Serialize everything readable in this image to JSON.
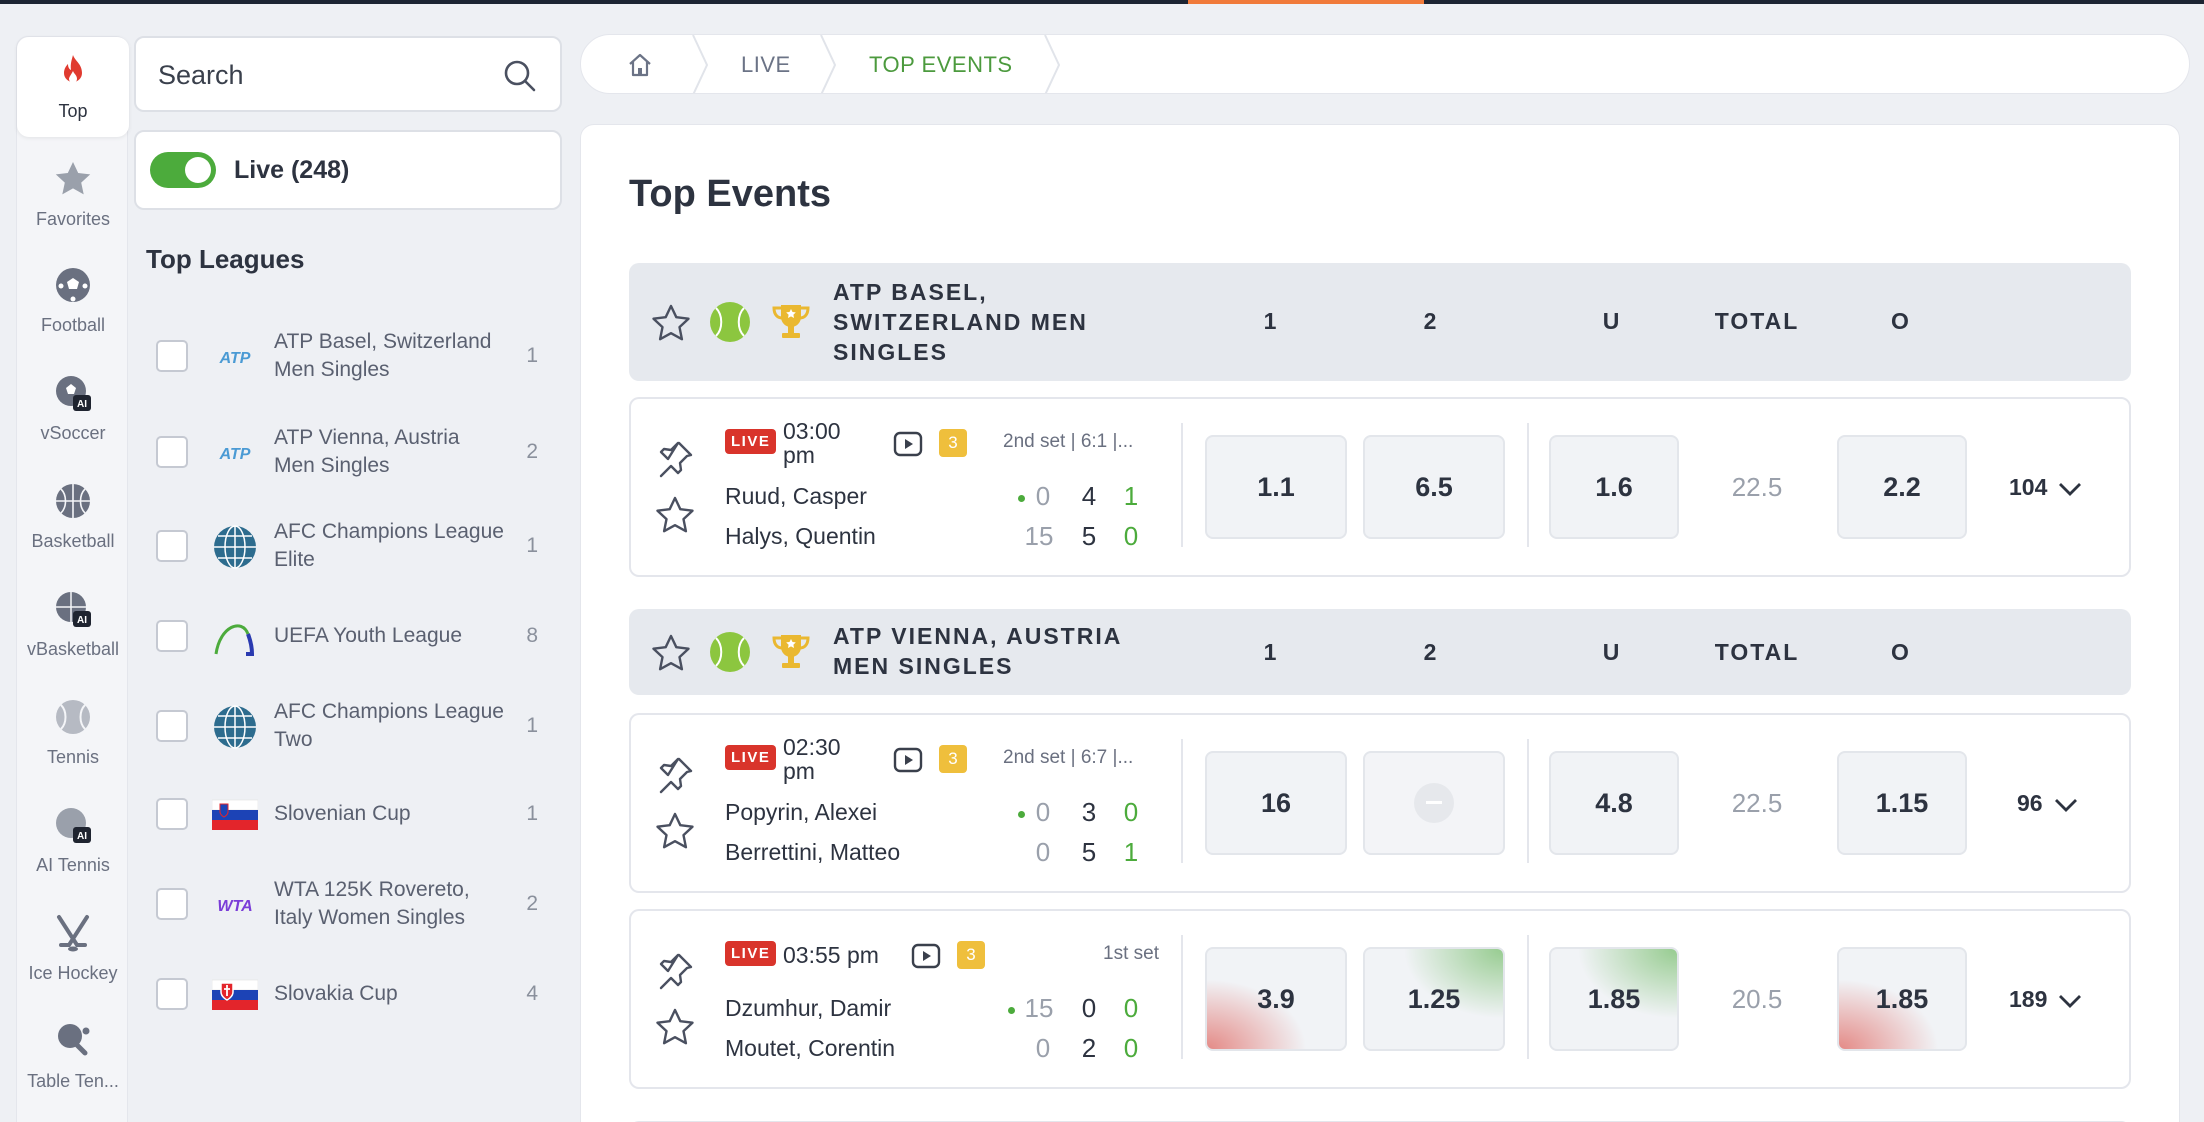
{
  "sports_rail": [
    {
      "label": "Top",
      "icon": "fire-icon",
      "active": true
    },
    {
      "label": "Favorites",
      "icon": "star-icon"
    },
    {
      "label": "Football",
      "icon": "football-icon"
    },
    {
      "label": "vSoccer",
      "icon": "vsoccer-icon"
    },
    {
      "label": "Basketball",
      "icon": "basketball-icon"
    },
    {
      "label": "vBasketball",
      "icon": "vbasketball-icon"
    },
    {
      "label": "Tennis",
      "icon": "tennis-icon"
    },
    {
      "label": "AI Tennis",
      "icon": "ai-tennis-icon"
    },
    {
      "label": "Ice Hockey",
      "icon": "ice-hockey-icon"
    },
    {
      "label": "Table Ten...",
      "icon": "table-tennis-icon"
    }
  ],
  "ai_badge": "AI",
  "search": {
    "placeholder": "Search"
  },
  "live_filter": {
    "label": "Live (248)",
    "on": true
  },
  "top_leagues": {
    "title": "Top Leagues",
    "items": [
      {
        "name": "ATP Basel, Switzerland Men Singles",
        "count": "1",
        "logo": "atp-logo"
      },
      {
        "name": "ATP Vienna, Austria Men Singles",
        "count": "2",
        "logo": "atp-logo"
      },
      {
        "name": "AFC Champions League Elite",
        "count": "1",
        "logo": "globe-icon"
      },
      {
        "name": "UEFA Youth League",
        "count": "8",
        "logo": "uefa-arc-icon"
      },
      {
        "name": "AFC Champions League Two",
        "count": "1",
        "logo": "globe-icon"
      },
      {
        "name": "Slovenian Cup",
        "count": "1",
        "logo": "slovenia-flag"
      },
      {
        "name": "WTA 125K Rovereto, Italy Women Singles",
        "count": "2",
        "logo": "wta-logo"
      },
      {
        "name": "Slovakia Cup",
        "count": "4",
        "logo": "slovakia-flag"
      }
    ],
    "logo_text_atp": "ATP",
    "logo_text_wta": "WTA"
  },
  "breadcrumb": {
    "items": [
      "LIVE",
      "TOP EVENTS"
    ]
  },
  "main": {
    "title": "Top Events",
    "columns": [
      "1",
      "2",
      "U",
      "TOTAL",
      "O"
    ],
    "live_label": "LIVE",
    "leagues": [
      {
        "title": "ATP BASEL, SWITZERLAND MEN SINGLES",
        "events": [
          {
            "time": "03:00 pm",
            "streams": "3",
            "set_info": "2nd set  |  6:1  |...",
            "home": {
              "name": "Ruud, Casper",
              "points": "0",
              "games": "4",
              "sets": "1",
              "serving": true
            },
            "away": {
              "name": "Halys, Quentin",
              "points": "15",
              "games": "5",
              "sets": "0"
            },
            "odds": {
              "o1": "1.1",
              "o2": "6.5",
              "under": "1.6",
              "total": "22.5",
              "over": "2.2"
            },
            "markets": "104"
          }
        ]
      },
      {
        "title": "ATP VIENNA, AUSTRIA MEN SINGLES",
        "events": [
          {
            "time": "02:30 pm",
            "streams": "3",
            "set_info": "2nd set  |  6:7  |...",
            "home": {
              "name": "Popyrin, Alexei",
              "points": "0",
              "games": "3",
              "sets": "0",
              "serving": true
            },
            "away": {
              "name": "Berrettini, Matteo",
              "points": "0",
              "games": "5",
              "sets": "1"
            },
            "odds": {
              "o1": "16",
              "o2": "",
              "under": "4.8",
              "total": "22.5",
              "over": "1.15"
            },
            "markets": "96"
          },
          {
            "time": "03:55 pm",
            "streams": "3",
            "set_info": "1st set",
            "home": {
              "name": "Dzumhur, Damir",
              "points": "15",
              "games": "0",
              "sets": "0",
              "serving": true
            },
            "away": {
              "name": "Moutet, Corentin",
              "points": "0",
              "games": "2",
              "sets": "0"
            },
            "odds": {
              "o1": "3.9",
              "o2": "1.25",
              "under": "1.85",
              "total": "20.5",
              "over": "1.85"
            },
            "markets": "189"
          }
        ]
      }
    ]
  },
  "colors": {
    "accent_green": "#4cab3c",
    "live_red": "#d9342b",
    "badge_yellow": "#efbf3c",
    "top_accent": "#f07a3a"
  }
}
